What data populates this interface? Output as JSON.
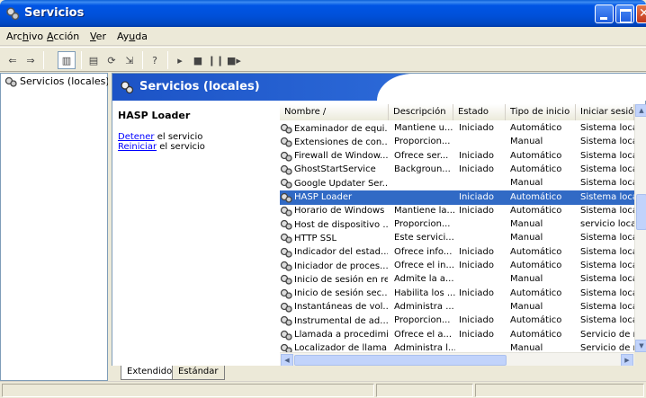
{
  "window": {
    "title": "Servicios"
  },
  "menu": [
    {
      "label": "Archivo",
      "access": "h"
    },
    {
      "label": "Acción",
      "access": "A"
    },
    {
      "label": "Ver",
      "access": "V"
    },
    {
      "label": "Ayuda",
      "access": "u"
    }
  ],
  "tree": {
    "root_label": "Servicios (locales)"
  },
  "pane": {
    "title": "Servicios (locales)"
  },
  "description": {
    "service_name": "HASP Loader",
    "stop_link": "Detener",
    "stop_suffix": " el servicio",
    "restart_link": "Reiniciar",
    "restart_suffix": " el servicio"
  },
  "list": {
    "columns": [
      "Nombre  /",
      "Descripción",
      "Estado",
      "Tipo de inicio",
      "Iniciar sesión c"
    ],
    "selected_index": 5,
    "rows": [
      [
        "Examinador de equi...",
        "Mantiene u...",
        "Iniciado",
        "Automático",
        "Sistema local"
      ],
      [
        "Extensiones de con...",
        "Proporcion...",
        "",
        "Manual",
        "Sistema local"
      ],
      [
        "Firewall de Window...",
        "Ofrece ser...",
        "Iniciado",
        "Automático",
        "Sistema local"
      ],
      [
        "GhostStartService",
        "Backgroun...",
        "Iniciado",
        "Automático",
        "Sistema local"
      ],
      [
        "Google Updater Ser...",
        "",
        "",
        "Manual",
        "Sistema local"
      ],
      [
        "HASP Loader",
        "",
        "Iniciado",
        "Automático",
        "Sistema local"
      ],
      [
        "Horario de Windows",
        "Mantiene la...",
        "Iniciado",
        "Automático",
        "Sistema local"
      ],
      [
        "Host de dispositivo ...",
        "Proporcion...",
        "",
        "Manual",
        "servicio local"
      ],
      [
        "HTTP SSL",
        "Este servici...",
        "",
        "Manual",
        "Sistema local"
      ],
      [
        "Indicador del estad...",
        "Ofrece info...",
        "Iniciado",
        "Automático",
        "Sistema local"
      ],
      [
        "Iniciador de proces...",
        "Ofrece el in...",
        "Iniciado",
        "Automático",
        "Sistema local"
      ],
      [
        "Inicio de sesión en red",
        "Admite la a...",
        "",
        "Manual",
        "Sistema local"
      ],
      [
        "Inicio de sesión sec...",
        "Habilita los ...",
        "Iniciado",
        "Automático",
        "Sistema local"
      ],
      [
        "Instantáneas de vol...",
        "Administra ...",
        "",
        "Manual",
        "Sistema local"
      ],
      [
        "Instrumental de ad...",
        "Proporcion...",
        "Iniciado",
        "Automático",
        "Sistema local"
      ],
      [
        "Llamada a procedimi...",
        "Ofrece el a...",
        "Iniciado",
        "Automático",
        "Servicio de red"
      ],
      [
        "Localizador de llama...",
        "Administra l...",
        "",
        "Manual",
        "Servicio de red"
      ]
    ]
  },
  "tabs": [
    "Extendido",
    "Estándar"
  ],
  "colors": {
    "selection": "#316ac5",
    "titlebar": "#0055e5",
    "link": "#0000ff"
  }
}
